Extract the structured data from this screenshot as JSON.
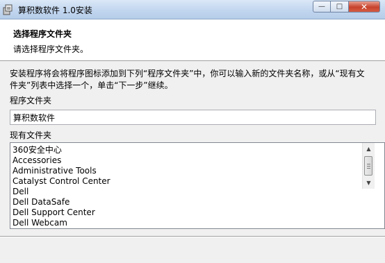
{
  "window": {
    "title": "算积数软件 1.0安装",
    "minimize_glyph": "—",
    "maximize_glyph": "□",
    "close_glyph": "✕"
  },
  "header": {
    "title": "选择程序文件夹",
    "subtitle": "请选择程序文件夹。"
  },
  "description": "安装程序将会将程序图标添加到下列“程序文件夹”中，你可以输入新的文件夹名称，或从“现有文件夹”列表中选择一个，单击“下一步”继续。",
  "program_folder": {
    "label": "程序文件夹",
    "value": "算积数软件"
  },
  "existing_folders": {
    "label": "现有文件夹",
    "items": [
      "360安全中心",
      "Accessories",
      "Administrative Tools",
      "Catalyst Control Center",
      "Dell",
      "Dell DataSafe",
      "Dell Support Center",
      "Dell Webcam"
    ]
  },
  "scrollbar": {
    "up_glyph": "▲",
    "down_glyph": "▼"
  },
  "colors": {
    "titlebar": "#c2d6ef",
    "close_button": "#c7422c",
    "panel_bg": "#f0f0f0",
    "header_bg": "#ffffff"
  }
}
